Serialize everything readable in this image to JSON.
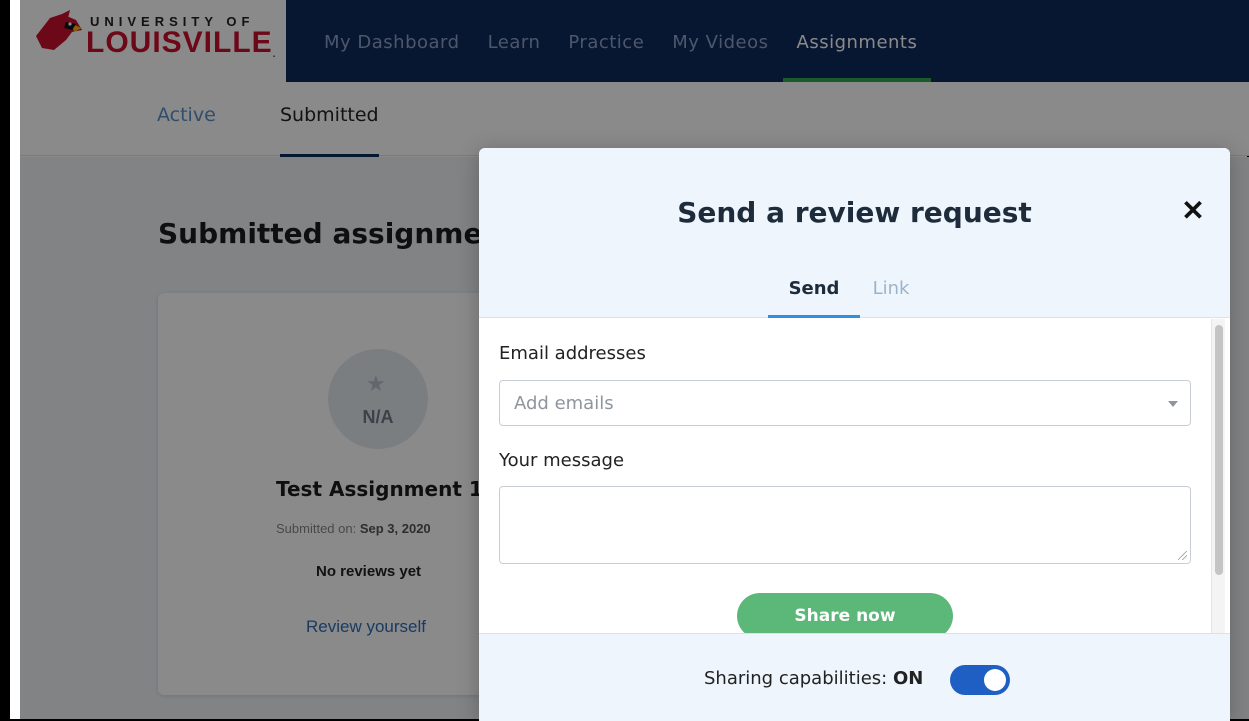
{
  "brand": {
    "university_line": "UNIVERSITY OF",
    "name_line": "LOUISVILLE",
    "registered_mark": "."
  },
  "nav": {
    "items": [
      {
        "label": "My Dashboard",
        "active": false
      },
      {
        "label": "Learn",
        "active": false
      },
      {
        "label": "Practice",
        "active": false
      },
      {
        "label": "My Videos",
        "active": false
      },
      {
        "label": "Assignments",
        "active": true
      }
    ]
  },
  "subtabs": {
    "items": [
      {
        "label": "Active",
        "active": false
      },
      {
        "label": "Submitted",
        "active": true
      }
    ]
  },
  "page": {
    "title": "Submitted assignmer"
  },
  "assignment_card": {
    "score": "N/A",
    "title": "Test Assignment 1",
    "submitted_prefix": "Submitted on: ",
    "submitted_date": "Sep 3, 2020",
    "reviews": "No reviews yet",
    "review_link": "Review yourself"
  },
  "modal": {
    "title": "Send a review request",
    "tabs": [
      {
        "label": "Send",
        "active": true
      },
      {
        "label": "Link",
        "active": false
      }
    ],
    "email_label": "Email addresses",
    "email_placeholder": "Add emails",
    "message_label": "Your message",
    "message_value": "",
    "share_button": "Share now",
    "sharing_label": "Sharing capabilities: ",
    "sharing_state": "ON",
    "sharing_enabled": true
  },
  "colors": {
    "nav_bg": "#0e2a5c",
    "nav_active_underline": "#2fa84f",
    "brand_red": "#c8102e",
    "tab_active_underline": "#2f8fe0",
    "share_button": "#5cb878",
    "toggle_on": "#1f5fc4"
  }
}
